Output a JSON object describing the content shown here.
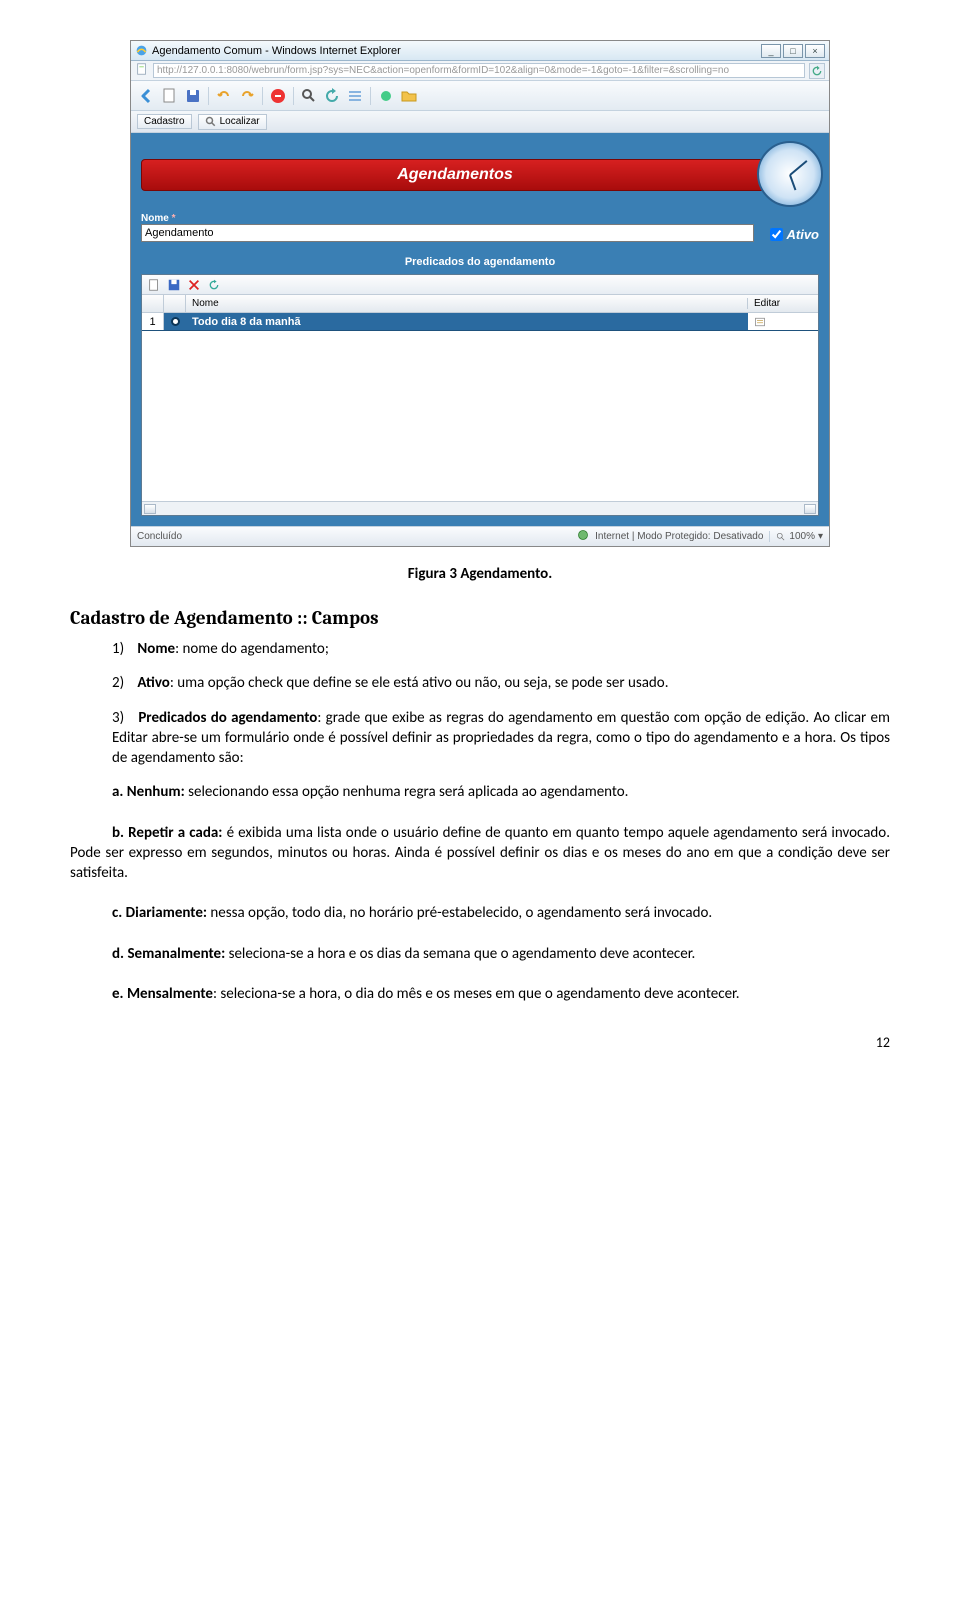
{
  "window": {
    "title": "Agendamento Comum - Windows Internet Explorer",
    "url": "http://127.0.0.1:8080/webrun/form.jsp?sys=NEC&action=openform&formID=102&align=0&mode=-1&goto=-1&filter=&scrolling=no"
  },
  "subbar": {
    "cadastro": "Cadastro",
    "localizar": "Localizar"
  },
  "app": {
    "banner_title": "Agendamentos",
    "nome_label": "Nome",
    "nome_value": "Agendamento",
    "ativo_label": "Ativo",
    "predicados_title": "Predicados do agendamento",
    "grid": {
      "col_nome": "Nome",
      "col_editar": "Editar",
      "row1_num": "1",
      "row1_text": "Todo dia 8 da manhã"
    }
  },
  "status": {
    "left": "Concluído",
    "mode": "Internet | Modo Protegido: Desativado",
    "zoom": "100%"
  },
  "doc": {
    "caption": "Figura 3 Agendamento.",
    "h2": "Cadastro de Agendamento :: Campos",
    "li1_label": "Nome",
    "li1_rest": ": nome do agendamento;",
    "li2_label": "Ativo",
    "li2_rest": ": uma opção check que define se ele está ativo ou não, ou seja, se pode ser usado.",
    "li3_label": "Predicados do agendamento",
    "li3_rest": ": grade que exibe as regras do agendamento em questão com opção de edição. Ao clicar em Editar abre-se um formulário onde é possível definir as propriedades da regra, como o tipo do agendamento e a hora. Os tipos de agendamento são:",
    "pa_label": "a. Nenhum:",
    "pa_rest": " selecionando essa opção nenhuma regra será aplicada ao agendamento.",
    "pb_label": "b. Repetir a cada:",
    "pb_rest": "  é exibida uma lista onde o usuário define de quanto em quanto tempo aquele agendamento será invocado. Pode ser expresso em segundos, minutos ou horas. Ainda é possível definir os dias e os meses do ano em que a condição deve ser satisfeita.",
    "pc_label": "c. Diariamente:",
    "pc_rest": " nessa opção, todo dia, no horário pré-estabelecido, o agendamento será invocado.",
    "pd_label": "d. Semanalmente:",
    "pd_rest": " seleciona-se a hora e os dias da semana que o agendamento deve acontecer.",
    "pe_label": "e. Mensalmente",
    "pe_rest": ": seleciona-se a hora, o dia do mês e os meses em que o agendamento deve acontecer.",
    "pagenum": "12"
  }
}
